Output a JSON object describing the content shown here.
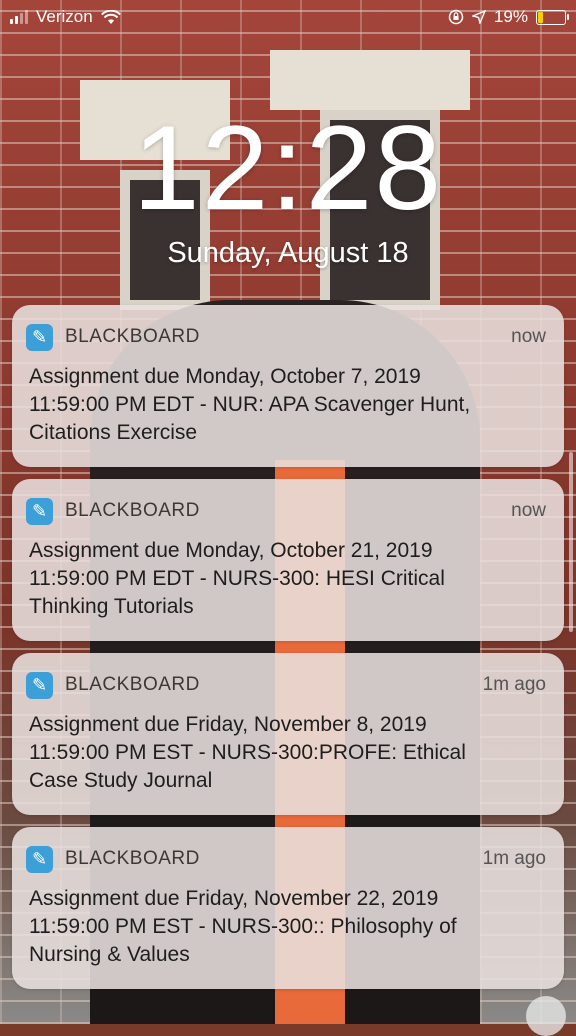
{
  "status_bar": {
    "carrier": "Verizon",
    "battery_percent": "19%",
    "battery_level": 0.19,
    "icons": [
      "signal-icon",
      "wifi-icon",
      "orientation-lock-icon",
      "location-icon",
      "battery-icon"
    ]
  },
  "lockscreen": {
    "time": "12:28",
    "date": "Sunday, August 18"
  },
  "notifications": [
    {
      "app": "BLACKBOARD",
      "time": "now",
      "line1": "Assignment due Monday, October 7, 2019",
      "line2": "11:59:00 PM EDT - NUR: APA Scavenger Hunt,",
      "line3": "Citations Exercise"
    },
    {
      "app": "BLACKBOARD",
      "time": "now",
      "line1": "Assignment due Monday, October 21, 2019",
      "line2": "11:59:00 PM EDT - NURS-300: HESI Critical",
      "line3": "Thinking Tutorials"
    },
    {
      "app": "BLACKBOARD",
      "time": "1m ago",
      "line1": "Assignment due Friday, November 8, 2019",
      "line2": "11:59:00 PM EST - NURS-300:PROFE: Ethical",
      "line3": "Case Study Journal"
    },
    {
      "app": "BLACKBOARD",
      "time": "1m ago",
      "line1": "Assignment due Friday, November 22, 2019",
      "line2": "11:59:00 PM EST - NURS-300:: Philosophy of",
      "line3": "Nursing & Values"
    }
  ],
  "colors": {
    "app_icon": "#3d9fd8",
    "battery_low": "#ffcc00"
  }
}
